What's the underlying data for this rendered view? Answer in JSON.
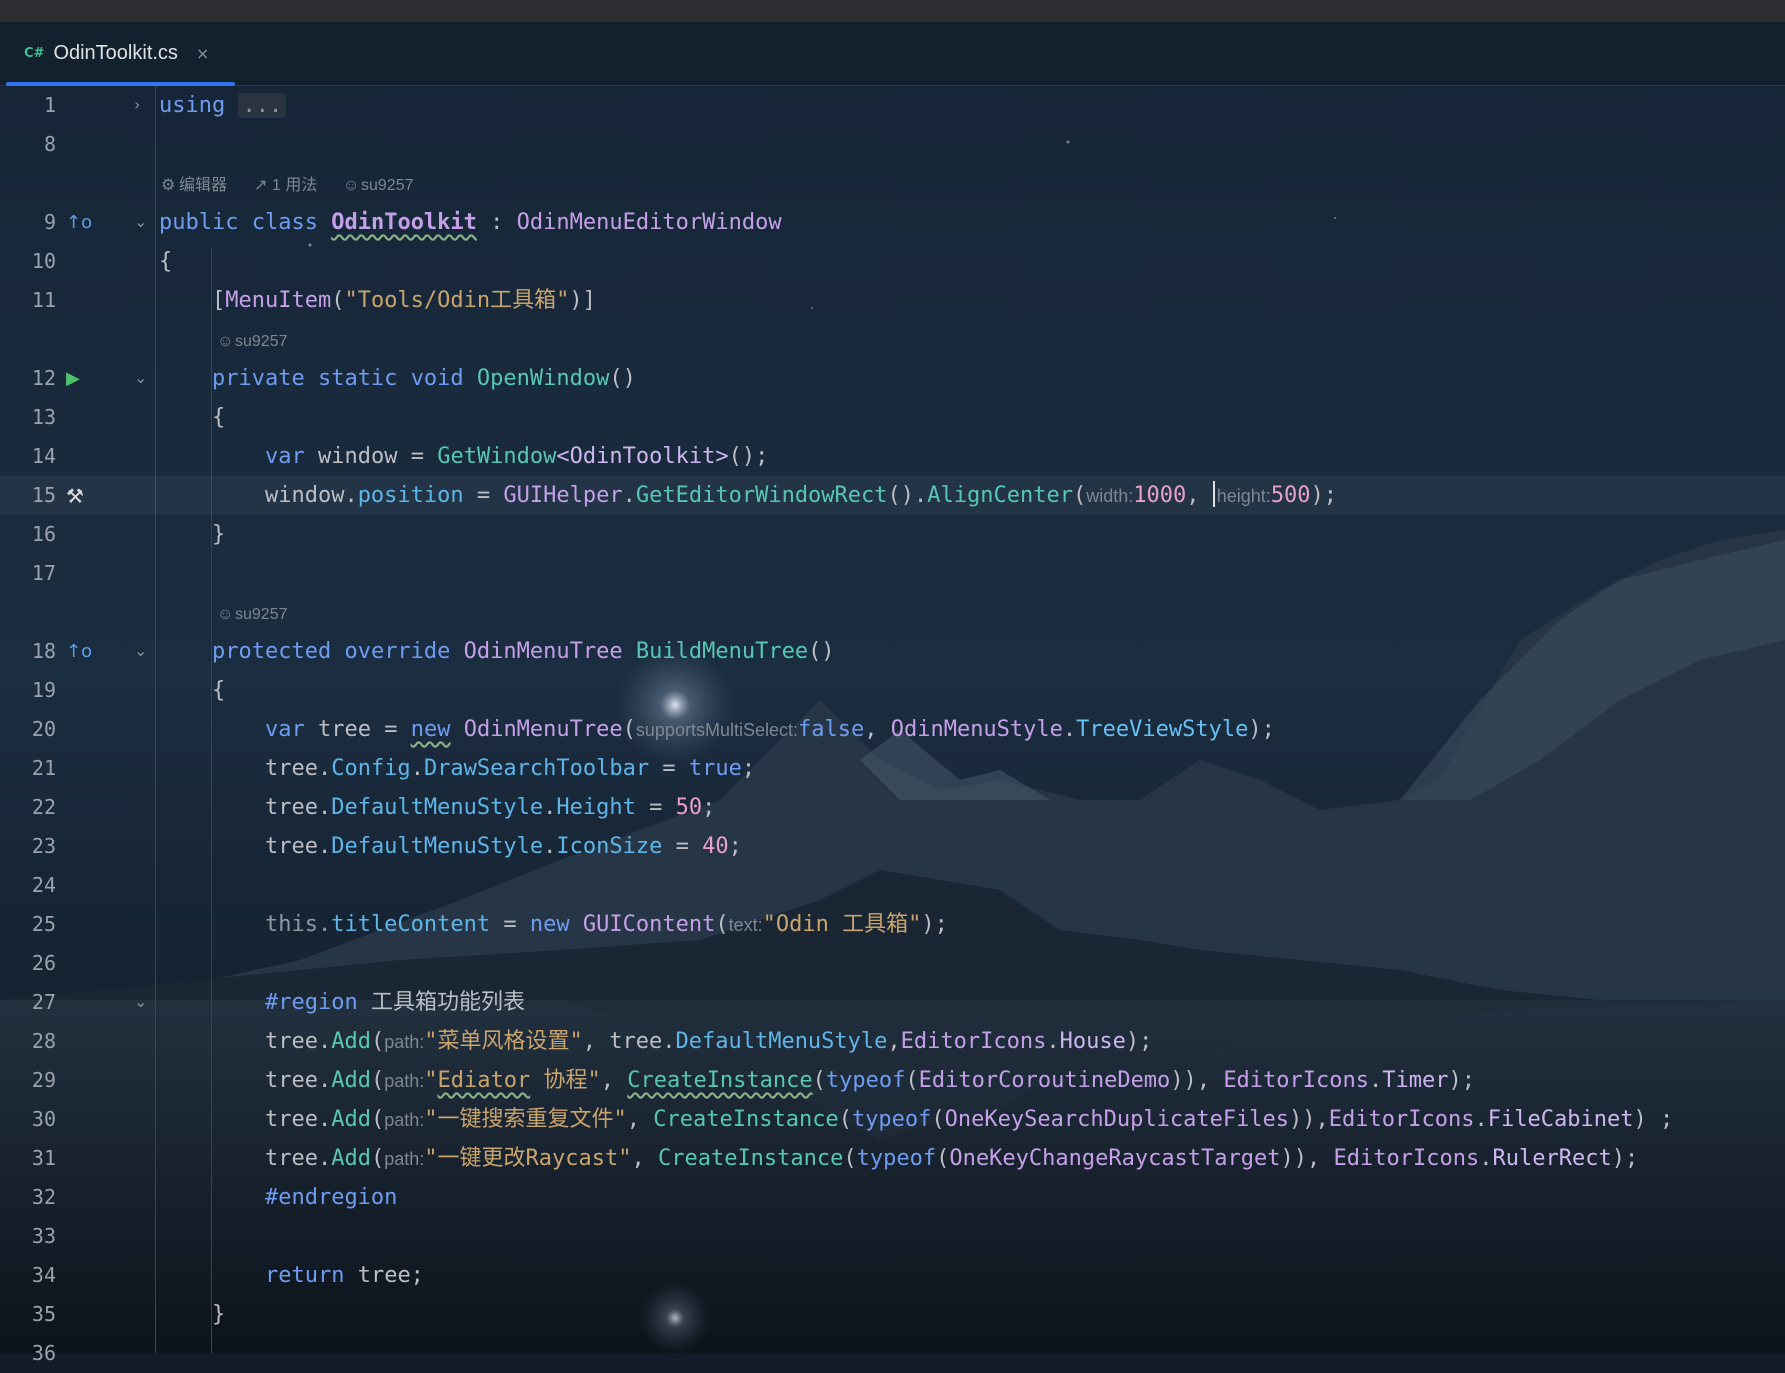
{
  "tab": {
    "lang_badge": "C#",
    "filename": "OdinToolkit.cs",
    "close": "×"
  },
  "line_numbers": [
    "1",
    "8",
    "9",
    "10",
    "11",
    "12",
    "13",
    "14",
    "15",
    "16",
    "17",
    "18",
    "19",
    "20",
    "21",
    "22",
    "23",
    "24",
    "25",
    "26",
    "27",
    "28",
    "29",
    "30",
    "31",
    "32",
    "33",
    "34",
    "35",
    "36"
  ],
  "hints": {
    "h9": {
      "editor": "编辑器",
      "usages": "1 用法",
      "author": "su9257"
    },
    "h12": {
      "author": "su9257"
    },
    "h18": {
      "author": "su9257"
    }
  },
  "params": {
    "width": "width:",
    "height": "height:",
    "multi": "supportsMultiSelect:",
    "text": "text:",
    "path": "path:"
  },
  "code": {
    "using": "using",
    "using_fold": "...",
    "public": "public",
    "class": "class",
    "class_name": "OdinToolkit",
    "colon": ":",
    "base": "OdinMenuEditorWindow",
    "brace_open": "{",
    "brace_close": "}",
    "attr_open": "[",
    "attr_name": "MenuItem",
    "attr_str": "\"Tools/Odin工具箱\"",
    "attr_close": ")]",
    "lparen": "(",
    "private": "private",
    "static": "static",
    "void": "void",
    "open_window": "OpenWindow",
    "empty_call": "()",
    "var": "var",
    "window_var": "window",
    "eq": "=",
    "get_window": "GetWindow",
    "generic": "<OdinToolkit>",
    "call_end": "();",
    "window_dot": "window.",
    "position": "position",
    "gui_helper": "GUIHelper",
    "dot": ".",
    "get_rect": "GetEditorWindowRect",
    "align_center": "AlignCenter",
    "v1000": "1000",
    "comma": ",",
    "v500": "500",
    "end_paren": ");",
    "protected": "protected",
    "override": "override",
    "menu_tree_type": "OdinMenuTree",
    "build_menu_tree": "BuildMenuTree",
    "tree_var": "tree",
    "new": "new",
    "false_kw": "false",
    "menu_style": "OdinMenuStyle",
    "tree_view_style": "TreeViewStyle",
    "tree_dot": "tree.",
    "config": "Config",
    "draw_search": "DrawSearchToolbar",
    "true_kw": "true",
    "semi": ";",
    "default_menu_style": "DefaultMenuStyle",
    "height_prop": "Height",
    "v50": "50",
    "icon_size": "IconSize",
    "v40": "40",
    "this_dot": "this.",
    "title_content": "titleContent",
    "gui_content": "GUIContent",
    "odin_str": "\"Odin 工具箱\"",
    "region": "#region",
    "region_label": "工具箱功能列表",
    "add": "Add",
    "s_style": "\"菜单风格设置\"",
    "editor_icons": "EditorIcons",
    "house": "House",
    "s_ediator_q": "\"",
    "s_ediator_word": "Ediator",
    "s_ediator_rest": " 协程\"",
    "create_instance": "CreateInstance",
    "typeof": "typeof",
    "coroutine_demo": "EditorCoroutineDemo",
    "close2": "))",
    "timer": "Timer",
    "s_dup": "\"一键搜索重复文件\"",
    "dup_type": "OneKeySearchDuplicateFiles",
    "file_cabinet": "FileCabinet",
    "sp_semi": ") ;",
    "s_raycast_cn": "\"一键更改",
    "s_raycast_en": "Raycast\"",
    "raycast_type": "OneKeyChangeRaycastTarget",
    "ruler_rect": "RulerRect",
    "endregion": "#endregion",
    "return": "return",
    "tree_semi": "tree;"
  },
  "colors": {
    "accent": "#3574f0",
    "keyword": "#6f9cf0",
    "type": "#c5a0e8",
    "method": "#57c7b4",
    "string": "#c9a46d",
    "number": "#e8a0c8"
  }
}
